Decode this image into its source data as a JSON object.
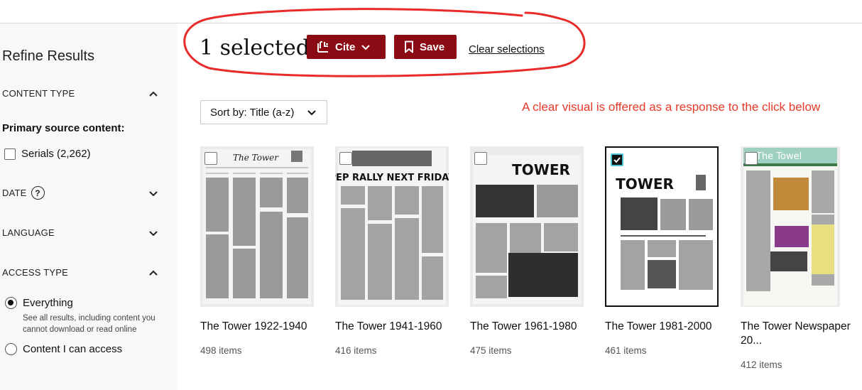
{
  "sidebar": {
    "title": "Refine Results",
    "content_type_label": "CONTENT TYPE",
    "primary_source_label": "Primary source content:",
    "serials_label": "Serials (2,262)",
    "date_label": "DATE",
    "language_label": "LANGUAGE",
    "access_type_label": "ACCESS TYPE",
    "everything_label": "Everything",
    "everything_desc": "See all results, including content you cannot download or read online",
    "content_access_label": "Content I can access"
  },
  "selection": {
    "count_text": "1 selected",
    "cite_label": "Cite",
    "save_label": "Save",
    "clear_label": "Clear selections"
  },
  "annotation_text": "A clear visual is offered as a response to the click below",
  "sort": {
    "label": "Sort by: Title (a-z)"
  },
  "items": [
    {
      "title": "The Tower 1922-1940",
      "count": "498 items",
      "selected": false,
      "masthead": "The Tower"
    },
    {
      "title": "The Tower 1941-1960",
      "count": "416 items",
      "selected": false,
      "masthead": "PEP RALLY NEXT FRIDAY"
    },
    {
      "title": "The Tower 1961-1980",
      "count": "475 items",
      "selected": false,
      "masthead": "TOWER"
    },
    {
      "title": "The Tower 1981-2000",
      "count": "461 items",
      "selected": true,
      "masthead": "TOWER"
    },
    {
      "title": "The Tower Newspaper 20...",
      "count": "412 items",
      "selected": false,
      "masthead": "The Towel"
    }
  ],
  "colors": {
    "accent": "#8b0a14",
    "annotation": "#e8392a",
    "sidebar_bg": "#f8f8f6"
  }
}
